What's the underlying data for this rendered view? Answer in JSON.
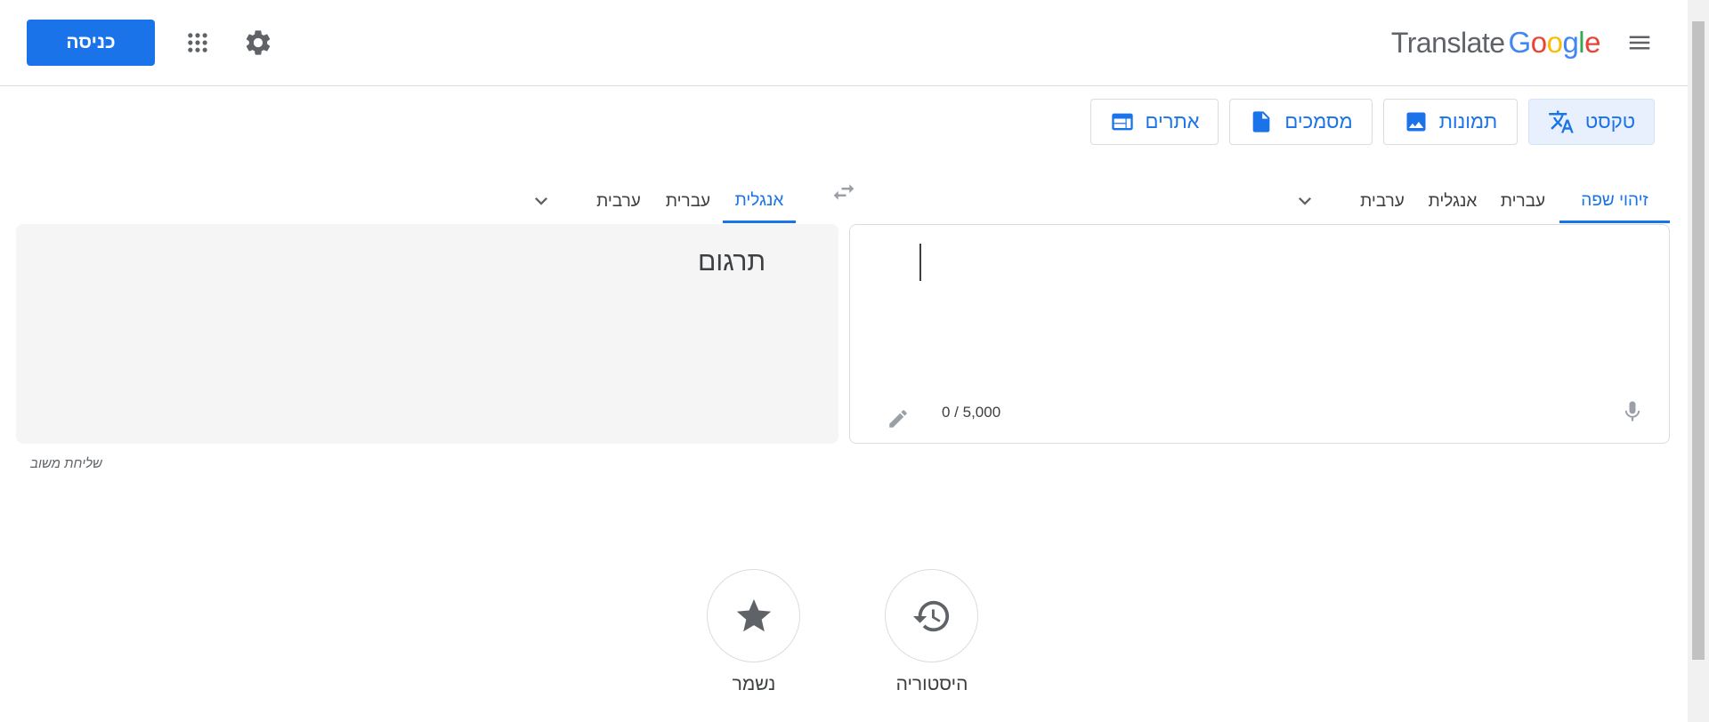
{
  "header": {
    "signin_label": "כניסה",
    "apps_icon": "apps-grid-icon",
    "settings_icon": "gear-icon",
    "menu_icon": "hamburger-menu-icon",
    "logo_google": [
      "G",
      "o",
      "o",
      "g",
      "l",
      "e"
    ],
    "logo_translate": "Translate"
  },
  "modes": [
    {
      "label": "טקסט",
      "icon": "translate-icon",
      "active": true
    },
    {
      "label": "תמונות",
      "icon": "image-icon",
      "active": false
    },
    {
      "label": "מסמכים",
      "icon": "document-icon",
      "active": false
    },
    {
      "label": "אתרים",
      "icon": "website-icon",
      "active": false
    }
  ],
  "source_langs": {
    "detect": "זיהוי שפה",
    "lang1": "עברית",
    "lang2": "אנגלית",
    "lang3": "ערבית"
  },
  "target_langs": {
    "lang1": "אנגלית",
    "lang2": "עברית",
    "lang3": "ערבית"
  },
  "source": {
    "value": "",
    "counter": "0 / 5,000"
  },
  "target": {
    "placeholder": "תרגום"
  },
  "feedback_label": "שליחת משוב",
  "bottom": {
    "history_label": "היסטוריה",
    "saved_label": "נשמר"
  },
  "colors": {
    "accent": "#1a73e8",
    "border": "#dadce0",
    "target_bg": "#f5f5f5"
  }
}
